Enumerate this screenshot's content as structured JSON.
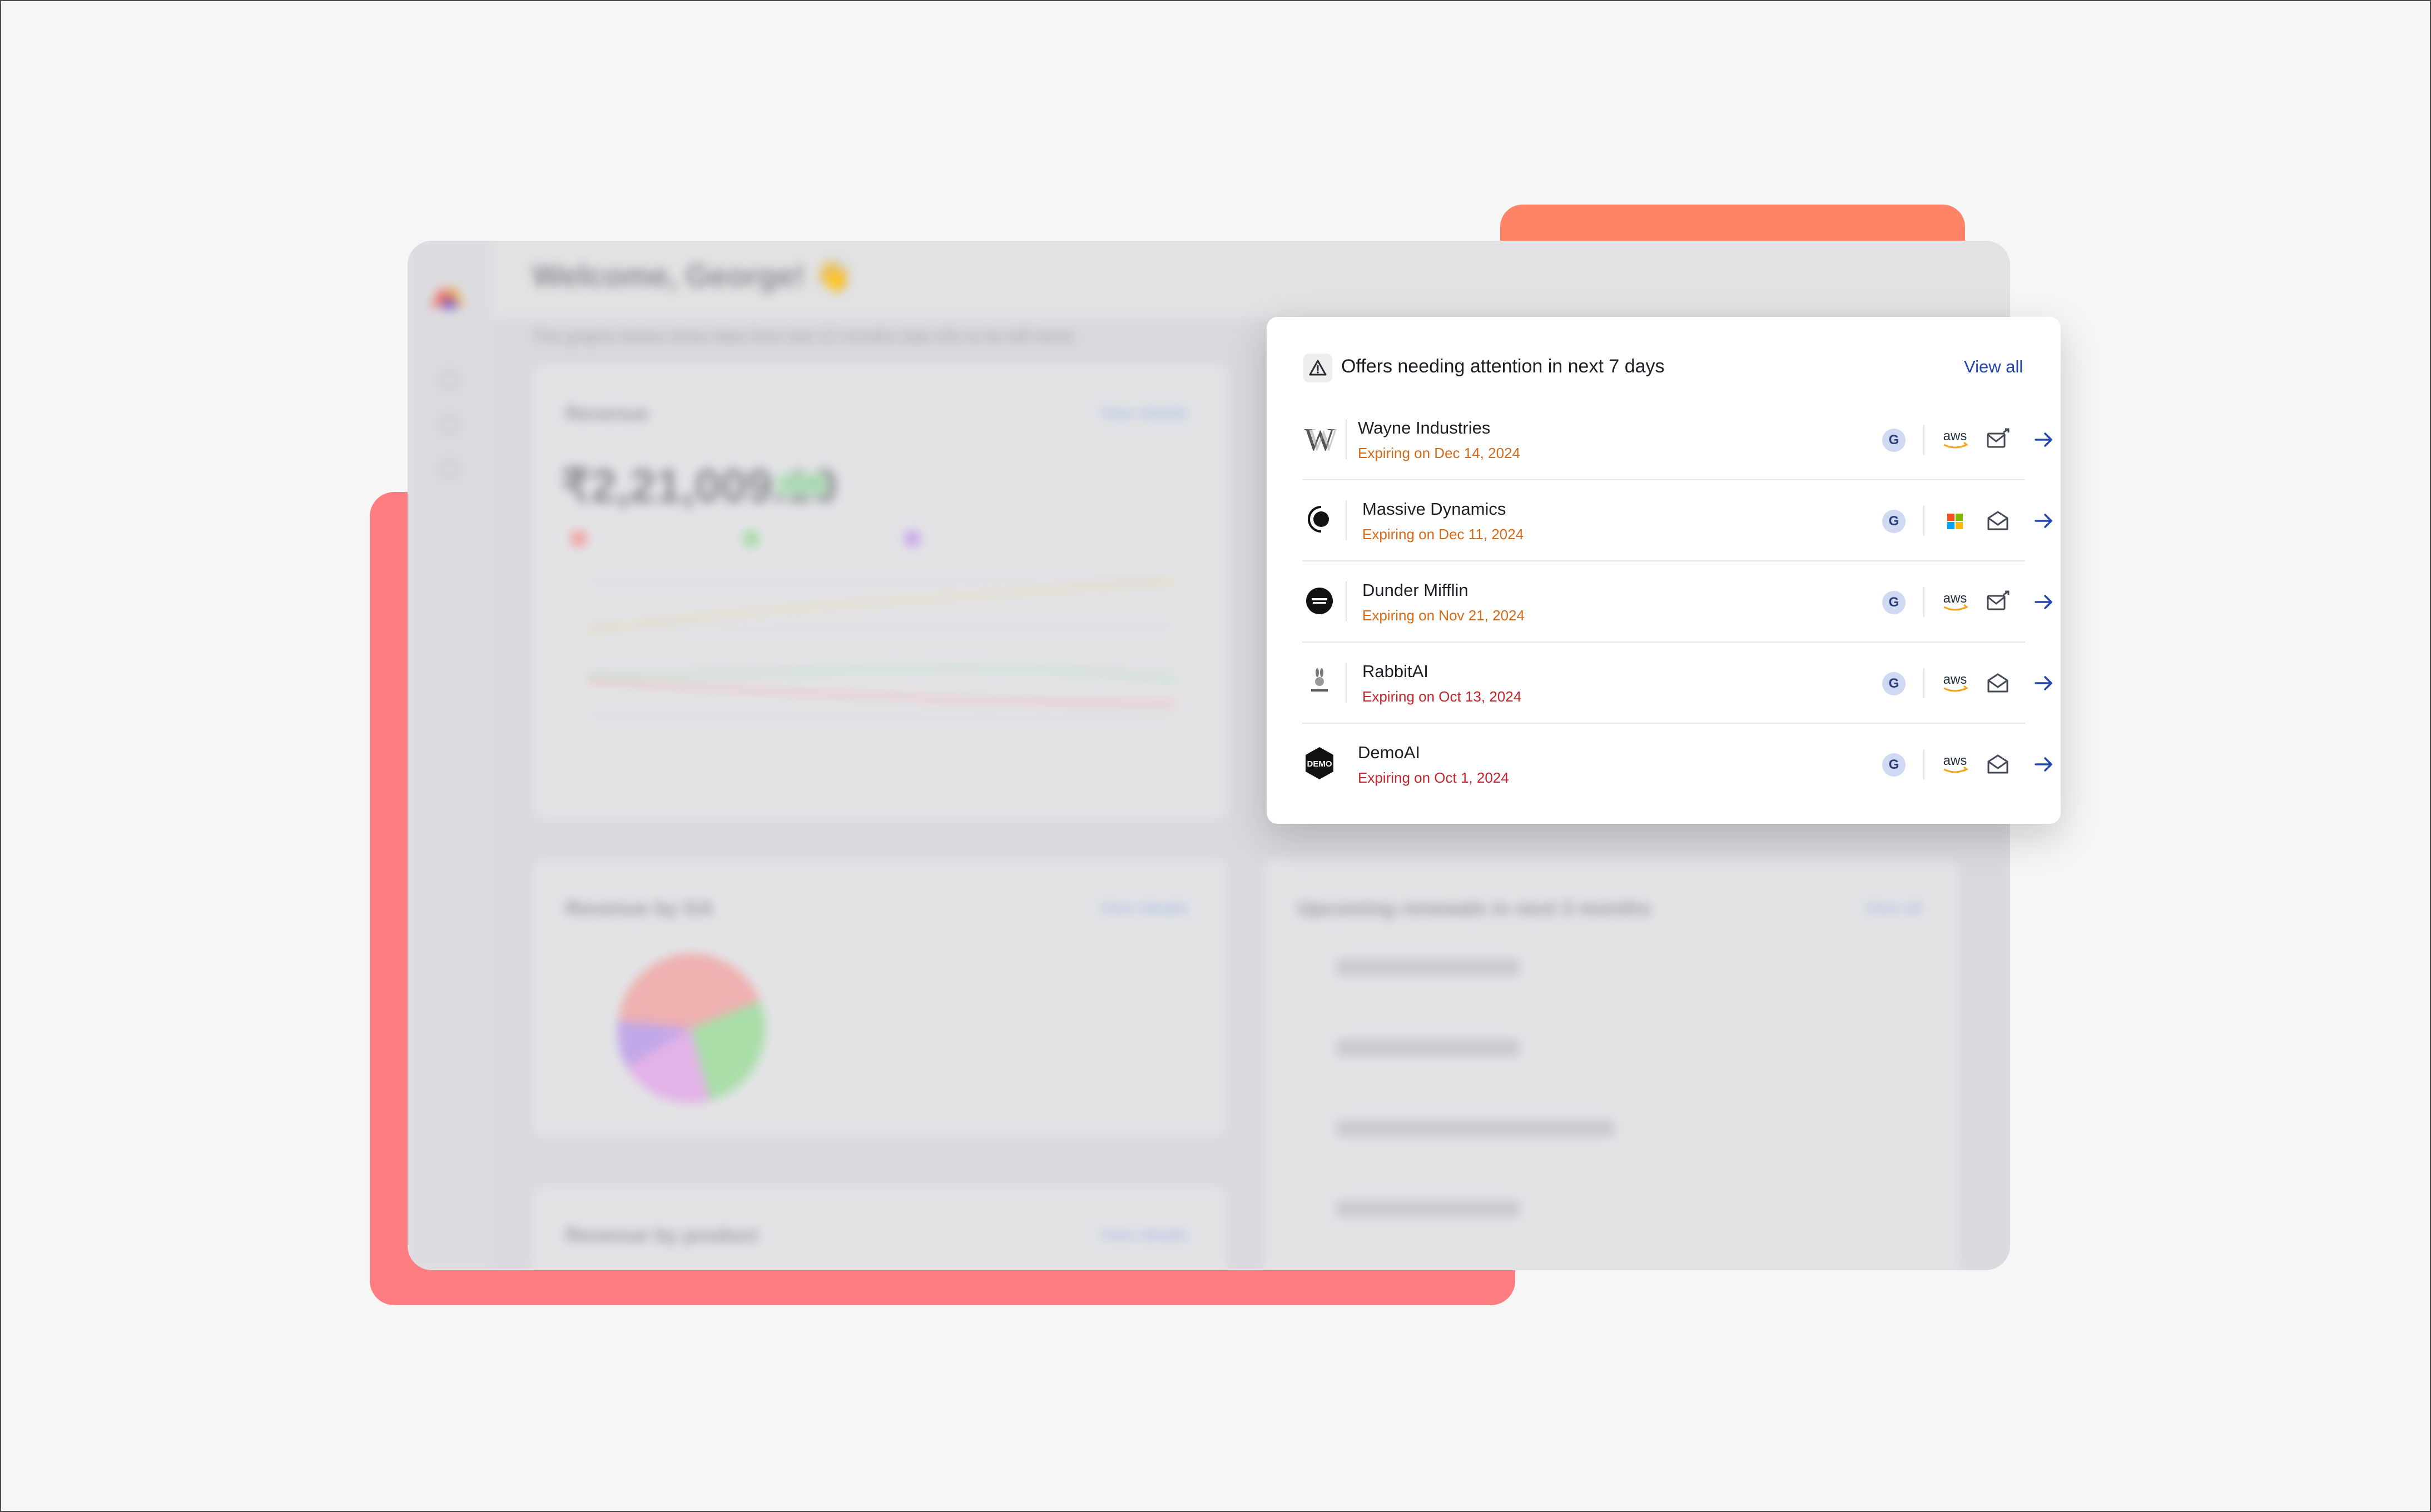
{
  "background": {
    "welcome": "Welcome, George! 👋",
    "subtitle": "The graphs below show data from last 12 months (tab info to be left here)",
    "revenue_title": "Revenue",
    "revenue_link": "View details",
    "revenue_value": "₹2,21,009.10",
    "revenue_chip": "+0.1%",
    "split_title": "Revenue by GA",
    "split_link": "View details",
    "upcoming_title": "Upcoming renewals in next 3 months",
    "upcoming_link": "View all",
    "product_title": "Revenue by product",
    "product_link": "View details"
  },
  "popup": {
    "title": "Offers needing attention in next 7 days",
    "view_all": "View all",
    "rows": [
      {
        "company": "Wayne Industries",
        "expiry": "Expiring on Dec 14, 2024",
        "badge": "G",
        "provider": "aws",
        "mail": "mail-sent-icon",
        "expiry_color": "#d66a16"
      },
      {
        "company": "Massive Dynamics",
        "expiry": "Expiring on Dec 11, 2024",
        "badge": "G",
        "provider": "microsoft",
        "mail": "mail-open-icon",
        "expiry_color": "#d66a16"
      },
      {
        "company": "Dunder Mifflin",
        "expiry": "Expiring on Nov 21, 2024",
        "badge": "G",
        "provider": "aws",
        "mail": "mail-sent-icon",
        "expiry_color": "#d66a16"
      },
      {
        "company": "RabbitAI",
        "expiry": "Expiring on Oct 13, 2024",
        "badge": "G",
        "provider": "aws",
        "mail": "mail-open-icon",
        "expiry_color": "#c4262e"
      },
      {
        "company": "DemoAI",
        "expiry": "Expiring on Oct 1, 2024",
        "badge": "G",
        "provider": "aws",
        "mail": "mail-open-icon",
        "expiry_color": "#c4262e"
      }
    ]
  },
  "colors": {
    "accent_orange": "#ff8467",
    "accent_red": "#ff7c80",
    "link_blue": "#2446b4",
    "badge_bg": "#cfd9f1"
  }
}
